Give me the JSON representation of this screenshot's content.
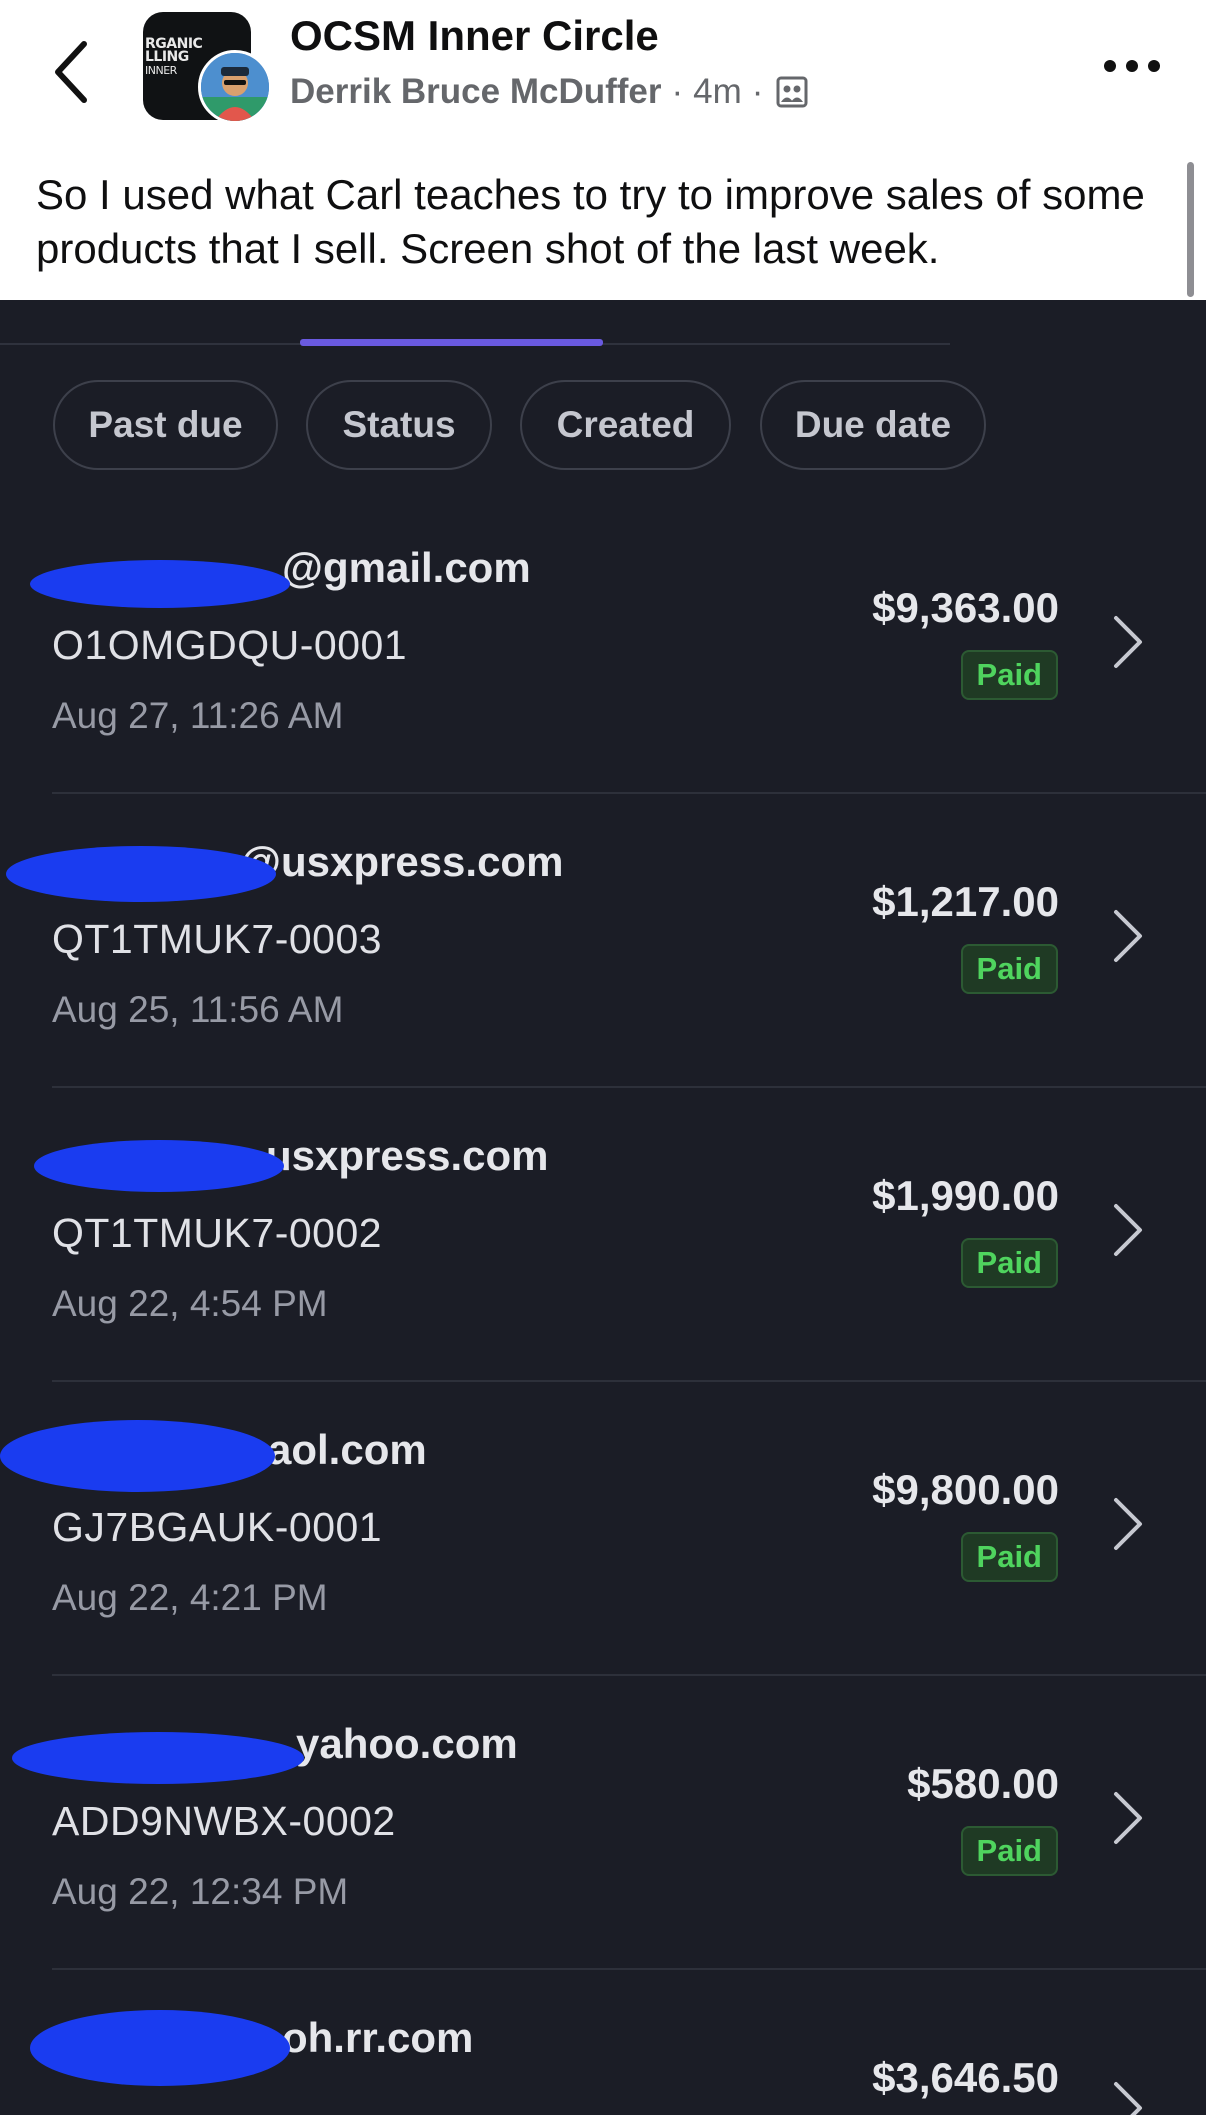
{
  "post": {
    "group_name": "OCSM Inner Circle",
    "group_avatar_text": [
      "RGANIC",
      "LLING",
      "INNER"
    ],
    "author": "Derrik Bruce McDuffer",
    "time": "4m",
    "separator": "·",
    "body": "So I used what Carl teaches to try to improve sales of some products that I sell. Screen shot of the last week."
  },
  "filters": [
    "Past due",
    "Status",
    "Created",
    "Due date"
  ],
  "invoices": [
    {
      "email_visible": "@gmail.com",
      "id": "O1OMGDQU-0001",
      "date": "Aug 27, 11:26 AM",
      "amount": "$9,363.00",
      "status": "Paid"
    },
    {
      "email_visible": "@usxpress.com",
      "id": "QT1TMUK7-0003",
      "date": "Aug 25, 11:56 AM",
      "amount": "$1,217.00",
      "status": "Paid"
    },
    {
      "email_visible": "usxpress.com",
      "id": "QT1TMUK7-0002",
      "date": "Aug 22, 4:54 PM",
      "amount": "$1,990.00",
      "status": "Paid"
    },
    {
      "email_visible": "aol.com",
      "id": "GJ7BGAUK-0001",
      "date": "Aug 22, 4:21 PM",
      "amount": "$9,800.00",
      "status": "Paid"
    },
    {
      "email_visible": "yahoo.com",
      "id": "ADD9NWBX-0002",
      "date": "Aug 22, 12:34 PM",
      "amount": "$580.00",
      "status": "Paid"
    },
    {
      "email_visible": "oh.rr.com",
      "amount": "$3,646.50"
    }
  ],
  "colors": {
    "app_background": "#1b1d26",
    "tab_indicator": "#6a5ae0",
    "paid_text": "#4fd45e",
    "redaction": "#1a3cf0"
  },
  "icons": {
    "back": "chevron-left-icon",
    "more": "more-horizontal-icon",
    "audience": "group-audience-icon",
    "row": "chevron-right-icon"
  }
}
